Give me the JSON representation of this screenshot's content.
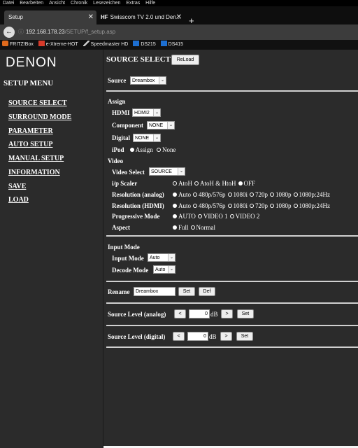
{
  "browser": {
    "menu": [
      "Datei",
      "Bearbeiten",
      "Ansicht",
      "Chronik",
      "Lesezeichen",
      "Extras",
      "Hilfe"
    ],
    "tabs": [
      {
        "title": "Setup"
      },
      {
        "title": "Swisscom TV 2.0 und Den..."
      }
    ],
    "url_host": "192.168.178.23",
    "url_path": "/SETUP/f_setup.asp",
    "bookmarks": [
      {
        "label": "FRITZ!Box",
        "icon": "fritzbox-icon",
        "color": "#e06a1c"
      },
      {
        "label": "e-Xtreme-HOT",
        "icon": "flag-icon",
        "color": "#d63a2a"
      },
      {
        "label": "Speedmaster HD",
        "icon": "pen-icon",
        "color": "#cccccc"
      },
      {
        "label": "DS215",
        "icon": "dsm-icon",
        "color": "#1d6fd1"
      },
      {
        "label": "DS415",
        "icon": "dsm-icon",
        "color": "#1d6fd1"
      }
    ]
  },
  "sidebar": {
    "logo": "DENON",
    "title": "SETUP MENU",
    "items": [
      "SOURCE SELECT",
      "SURROUND MODE",
      "PARAMETER",
      "AUTO SETUP",
      "MANUAL SETUP",
      "INFORMATION",
      "SAVE",
      "LOAD"
    ]
  },
  "header": {
    "title": "SOURCE SELECT",
    "reload_label": "ReLoad"
  },
  "source": {
    "label": "Source",
    "value": "Dreambox"
  },
  "assign": {
    "heading": "Assign",
    "hdmi": {
      "label": "HDMI",
      "value": "HDMI2"
    },
    "component": {
      "label": "Component",
      "value": "NONE"
    },
    "digital": {
      "label": "Digital",
      "value": "NONE"
    },
    "ipod": {
      "label": "iPod",
      "options": [
        "Assign",
        "None"
      ],
      "selected": 0
    }
  },
  "video": {
    "heading": "Video",
    "video_select": {
      "label": "Video Select",
      "value": "SOURCE"
    },
    "ip_scaler": {
      "label": "i/p Scaler",
      "options": [
        "AtoH",
        "AtoH & HtoH",
        "OFF"
      ],
      "selected": 2
    },
    "res_analog": {
      "label": "Resolution (analog)",
      "options": [
        "Auto",
        "480p/576p",
        "1080i",
        "720p",
        "1080p",
        "1080p:24Hz"
      ],
      "selected": 0
    },
    "res_hdmi": {
      "label": "Resolution (HDMI)",
      "options": [
        "Auto",
        "480p/576p",
        "1080i",
        "720p",
        "1080p",
        "1080p:24Hz"
      ],
      "selected": 0
    },
    "progressive": {
      "label": "Progressive Mode",
      "options": [
        "AUTO",
        "VIDEO 1",
        "VIDEO 2"
      ],
      "selected": 0
    },
    "aspect": {
      "label": "Aspect",
      "options": [
        "Full",
        "Normal"
      ],
      "selected": 0
    }
  },
  "input_mode": {
    "heading": "Input Mode",
    "input": {
      "label": "Input Mode",
      "value": "Auto"
    },
    "decode": {
      "label": "Decode Mode",
      "value": "Auto"
    }
  },
  "rename": {
    "label": "Rename",
    "value": "Dreambox",
    "set_label": "Set",
    "def_label": "Def"
  },
  "level_analog": {
    "label": "Source Level (analog)",
    "minus": "<",
    "value": "0",
    "unit": "dB",
    "plus": ">",
    "set_label": "Set"
  },
  "level_digital": {
    "label": "Source Level (digital)",
    "minus": "<",
    "value": "0",
    "unit": "dB",
    "plus": ">",
    "set_label": "Set"
  }
}
